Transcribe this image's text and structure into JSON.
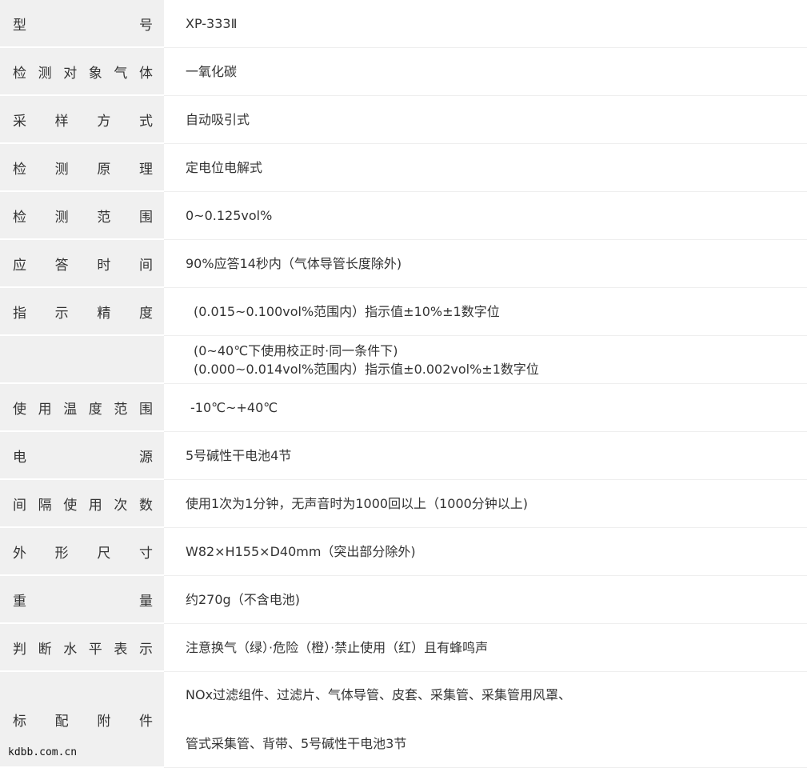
{
  "rows": [
    {
      "label": [
        "型",
        "号"
      ],
      "values": [
        "XP-333Ⅱ"
      ]
    },
    {
      "label": [
        "检",
        "测",
        "对",
        "象",
        "气",
        "体"
      ],
      "values": [
        "一氧化碳"
      ]
    },
    {
      "label": [
        "采",
        "样",
        "方",
        "式"
      ],
      "values": [
        "自动吸引式"
      ]
    },
    {
      "label": [
        "检",
        "测",
        "原",
        "理"
      ],
      "values": [
        "定电位电解式"
      ]
    },
    {
      "label": [
        "检",
        "测",
        "范",
        "围"
      ],
      "values": [
        "0~0.125vol%"
      ]
    },
    {
      "label": [
        "应",
        "答",
        "时",
        "间"
      ],
      "values": [
        "90%应答14秒内（气体导管长度除外)"
      ]
    },
    {
      "label": [
        "指",
        "示",
        "精",
        "度"
      ],
      "values": [
        "(0.015~0.100vol%范围内）指示值±10%±1数字位"
      ]
    },
    {
      "label": [],
      "values": [
        "(0~40℃下使用校正时·同一条件下)",
        "(0.000~0.014vol%范围内）指示值±0.002vol%±1数字位"
      ]
    },
    {
      "label": [
        "使",
        "用",
        "温",
        "度",
        "范",
        "围"
      ],
      "values": [
        "-10℃~+40℃"
      ]
    },
    {
      "label": [
        "电",
        "源"
      ],
      "values": [
        "5号碱性干电池4节"
      ]
    },
    {
      "label": [
        "间",
        "隔",
        "使",
        "用",
        "次",
        "数"
      ],
      "values": [
        "使用1次为1分钟，无声音时为1000回以上（1000分钟以上)"
      ]
    },
    {
      "label": [
        "外",
        "形",
        "尺",
        "寸"
      ],
      "values": [
        "W82×H155×D40mm（突出部分除外)"
      ]
    },
    {
      "label": [
        "重",
        "量"
      ],
      "values": [
        "约270g（不含电池)"
      ]
    },
    {
      "label": [
        "判",
        "断",
        "水",
        "平",
        "表",
        "示"
      ],
      "values": [
        "注意换气（绿）·危险（橙）·禁止使用（红）且有蜂鸣声"
      ]
    },
    {
      "label": [
        "标",
        "配",
        "附",
        "件"
      ],
      "values": [
        "NOx过滤组件、过滤片、气体导管、皮套、采集管、采集管用风罩、",
        "管式采集管、背带、5号碱性干电池3节"
      ]
    }
  ],
  "watermark": "kdbb.com.cn"
}
